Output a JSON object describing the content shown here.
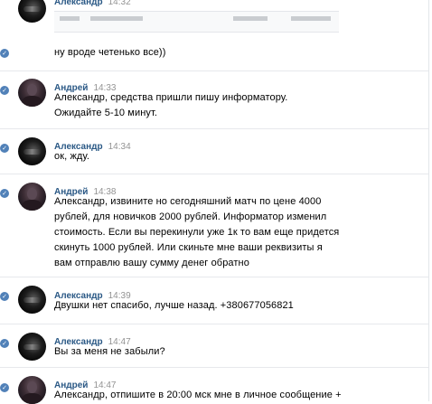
{
  "messages": [
    {
      "author": "Александр",
      "time": "14:32",
      "text": "ну вроде четенько все))",
      "avatar": "car-avatar",
      "has_attachment": true
    },
    {
      "author": "Андрей",
      "time": "14:33",
      "text": "Александр, средства пришли пишу информатору.\nОжидайте 5-10 минут.",
      "avatar": "person-avatar"
    },
    {
      "author": "Александр",
      "time": "14:34",
      "text": "ок, жду.",
      "avatar": "car-avatar"
    },
    {
      "author": "Андрей",
      "time": "14:38",
      "text": "Александр, извините но сегодняшний матч по цене 4000\nрублей, для новичков 2000 рублей. Информатор изменил\nстоимость. Если вы перекинули уже 1к то вам еще придется\nскинуть 1000 рублей. Или скиньте мне ваши реквизиты я\nвам отправлю вашу сумму денег обратно",
      "avatar": "person-avatar"
    },
    {
      "author": "Александр",
      "time": "14:39",
      "text": "Двушки нет спасибо, лучше назад. +380677056821",
      "avatar": "car-avatar"
    },
    {
      "author": "Александр",
      "time": "14:47",
      "text": "Вы за меня не забыли?",
      "avatar": "car-avatar"
    },
    {
      "author": "Андрей",
      "time": "14:47",
      "text": "Александр, отпишите в 20:00 мск мне в личное сообщение +",
      "avatar": "person-avatar"
    }
  ],
  "colors": {
    "author_link": "#2a5885",
    "timestamp": "#939393",
    "read_marker": "#5181b8",
    "separator": "#e7e8ec"
  }
}
